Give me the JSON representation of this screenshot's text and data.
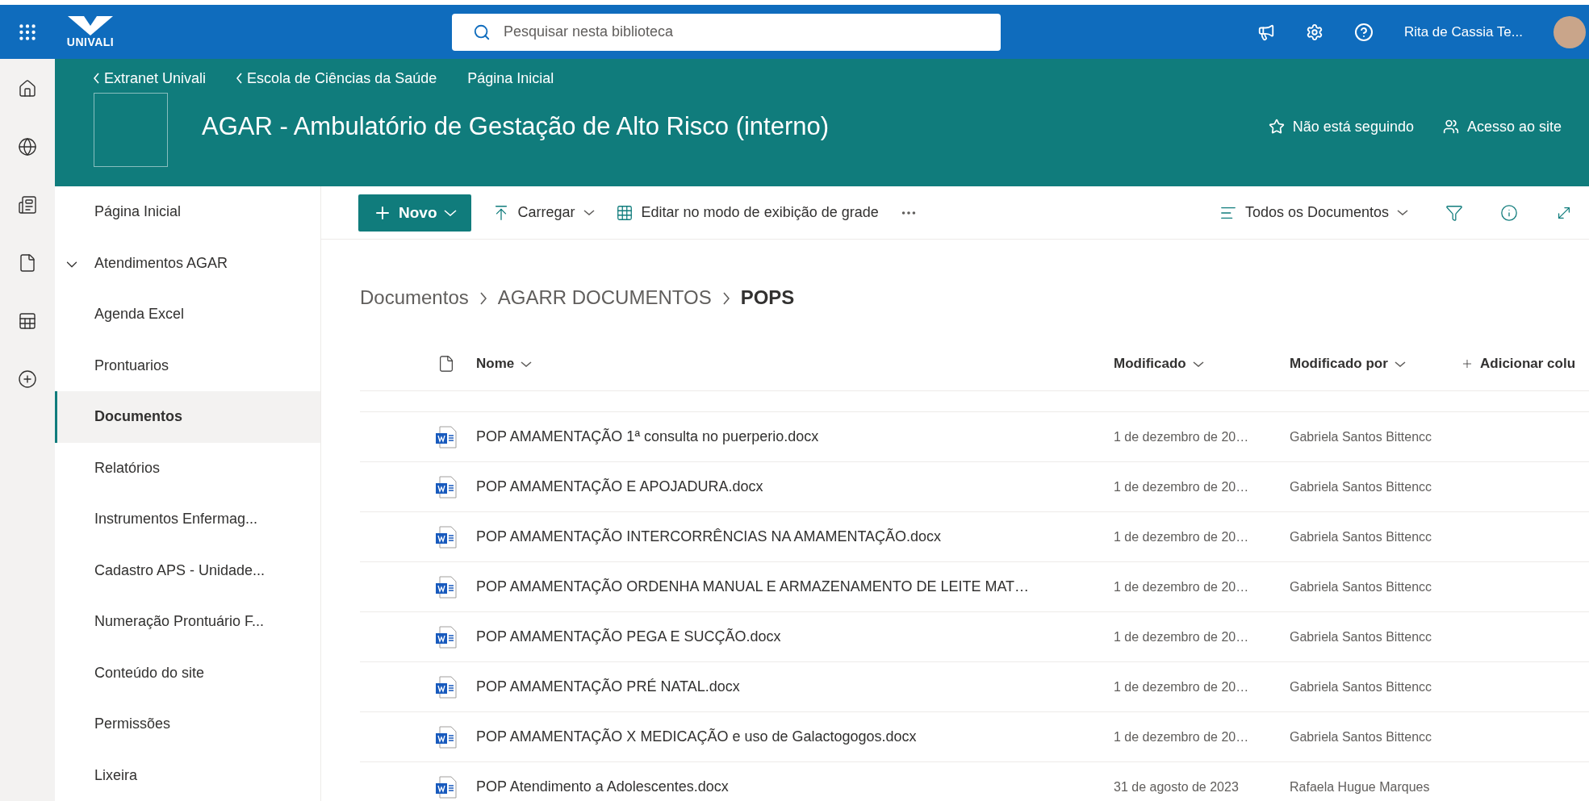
{
  "top_bar": {
    "logo_text": "UNIVALI",
    "search": {
      "placeholder": "Pesquisar nesta biblioteca"
    },
    "user_name": "Rita de Cassia Te..."
  },
  "site_header": {
    "breadcrumbs": [
      "Extranet Univali",
      "Escola de Ciências da Saúde",
      "Página Inicial"
    ],
    "title": "AGAR - Ambulatório de Gestação de Alto Risco (interno)",
    "actions": [
      {
        "kind": "follow",
        "label": "Não está seguindo"
      },
      {
        "kind": "access",
        "label": "Acesso ao site"
      }
    ]
  },
  "nav": {
    "items": [
      {
        "label": "Página Inicial",
        "selected": false
      },
      {
        "label": "Atendimentos AGAR",
        "selected": false,
        "expanded": true
      },
      {
        "label": "Agenda Excel",
        "selected": false
      },
      {
        "label": "Prontuarios",
        "selected": false
      },
      {
        "label": "Documentos",
        "selected": true
      },
      {
        "label": "Relatórios",
        "selected": false
      },
      {
        "label": "Instrumentos Enfermag...",
        "selected": false
      },
      {
        "label": "Cadastro APS - Unidade...",
        "selected": false
      },
      {
        "label": "Numeração Prontuário F...",
        "selected": false
      },
      {
        "label": "Conteúdo do site",
        "selected": false
      },
      {
        "label": "Permissões",
        "selected": false
      },
      {
        "label": "Lixeira",
        "selected": false
      }
    ]
  },
  "toolbar": {
    "new_button": "Novo",
    "upload": "Carregar",
    "grid_edit": "Editar no modo de exibição de grade",
    "view": "Todos os Documentos"
  },
  "breadcrumb": [
    "Documentos",
    "AGARR DOCUMENTOS",
    "POPS"
  ],
  "table": {
    "columns": [
      "Nome",
      "Modificado",
      "Modificado por",
      "Adicionar colu"
    ],
    "rows": [
      {
        "name": "POP AMAMENTAÇÃO 1ª consulta no puerperio.docx",
        "modified": "1 de dezembro de 20…",
        "modified_by": "Gabriela Santos Bittencc"
      },
      {
        "name": "POP AMAMENTAÇÃO E APOJADURA.docx",
        "modified": "1 de dezembro de 20…",
        "modified_by": "Gabriela Santos Bittencc"
      },
      {
        "name": "POP AMAMENTAÇÃO INTERCORRÊNCIAS NA AMAMENTAÇÃO.docx",
        "modified": "1 de dezembro de 20…",
        "modified_by": "Gabriela Santos Bittencc"
      },
      {
        "name": "POP AMAMENTAÇÃO ORDENHA MANUAL E ARMAZENAMENTO DE LEITE MAT…",
        "modified": "1 de dezembro de 20…",
        "modified_by": "Gabriela Santos Bittencc"
      },
      {
        "name": "POP AMAMENTAÇÃO PEGA E SUCÇÃO.docx",
        "modified": "1 de dezembro de 20…",
        "modified_by": "Gabriela Santos Bittencc"
      },
      {
        "name": "POP AMAMENTAÇÃO PRÉ NATAL.docx",
        "modified": "1 de dezembro de 20…",
        "modified_by": "Gabriela Santos Bittencc"
      },
      {
        "name": "POP AMAMENTAÇÃO X MEDICAÇÃO e uso de Galactogogos.docx",
        "modified": "1 de dezembro de 20…",
        "modified_by": "Gabriela Santos Bittencc"
      },
      {
        "name": "POP Atendimento a Adolescentes.docx",
        "modified": "31 de agosto de 2023",
        "modified_by": "Rafaela Hugue Marques"
      }
    ]
  }
}
